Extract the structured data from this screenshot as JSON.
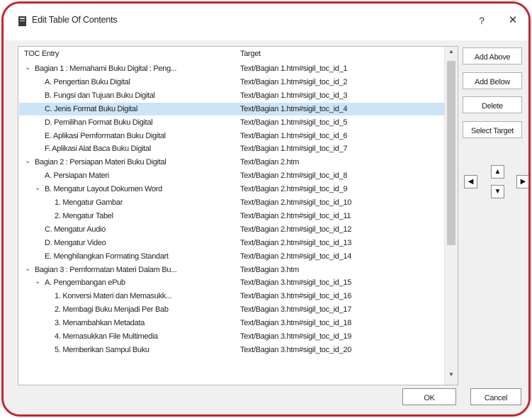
{
  "window": {
    "title": "Edit Table Of Contents",
    "help_label": "?",
    "close_label": "✕"
  },
  "columns": {
    "entry": "TOC Entry",
    "target": "Target"
  },
  "rows": [
    {
      "level": 0,
      "expand": "⌄",
      "entry": "Bagian 1 : Memahami Buku Digital : Peng...",
      "target": "Text/Bagian 1.htm#sigil_toc_id_1"
    },
    {
      "level": 1,
      "expand": "",
      "entry": "A. Pengertian Buku Digital",
      "target": "Text/Bagian 1.htm#sigil_toc_id_2"
    },
    {
      "level": 1,
      "expand": "",
      "entry": "B. Fungsi dan Tujuan Buku Digital",
      "target": "Text/Bagian 1.htm#sigil_toc_id_3"
    },
    {
      "level": 1,
      "expand": "",
      "entry": "C. Jenis Format Buku Digital",
      "target": "Text/Bagian 1.htm#sigil_toc_id_4",
      "selected": true
    },
    {
      "level": 1,
      "expand": "",
      "entry": "D. Pemilihan Format Buku Digital",
      "target": "Text/Bagian 1.htm#sigil_toc_id_5"
    },
    {
      "level": 1,
      "expand": "",
      "entry": "E. Aplikasi Pemformatan Buku Digital",
      "target": "Text/Bagian 1.htm#sigil_toc_id_6"
    },
    {
      "level": 1,
      "expand": "",
      "entry": "F. Aplikasi Alat Baca Buku Digital",
      "target": "Text/Bagian 1.htm#sigil_toc_id_7"
    },
    {
      "level": 0,
      "expand": "⌄",
      "entry": "Bagian 2 : Persiapan Materi Buku Digital",
      "target": "Text/Bagian 2.htm"
    },
    {
      "level": 1,
      "expand": "",
      "entry": "A. Persiapan Materi",
      "target": "Text/Bagian 2.htm#sigil_toc_id_8"
    },
    {
      "level": 1,
      "expand": "⌄",
      "entry": "B. Mengatur Layout Dokumen Word",
      "target": "Text/Bagian 2.htm#sigil_toc_id_9"
    },
    {
      "level": 2,
      "expand": "",
      "entry": "1. Mengatur Gambar",
      "target": "Text/Bagian 2.htm#sigil_toc_id_10"
    },
    {
      "level": 2,
      "expand": "",
      "entry": "2. Mengatur Tabel",
      "target": "Text/Bagian 2.htm#sigil_toc_id_11"
    },
    {
      "level": 1,
      "expand": "",
      "entry": "C. Mengatur Audio",
      "target": "Text/Bagian 2.htm#sigil_toc_id_12"
    },
    {
      "level": 1,
      "expand": "",
      "entry": "D. Mengatur Video",
      "target": "Text/Bagian 2.htm#sigil_toc_id_13"
    },
    {
      "level": 1,
      "expand": "",
      "entry": "E. Menghilangkan Formating Standart",
      "target": "Text/Bagian 2.htm#sigil_toc_id_14"
    },
    {
      "level": 0,
      "expand": "⌄",
      "entry": "Bagian 3 : Pemformatan Materi Dalam Bu...",
      "target": "Text/Bagian 3.htm"
    },
    {
      "level": 1,
      "expand": "⌄",
      "entry": "A. Pengembangan ePub",
      "target": "Text/Bagian 3.htm#sigil_toc_id_15"
    },
    {
      "level": 2,
      "expand": "",
      "entry": "1. Konversi Materi dan Memasukk...",
      "target": "Text/Bagian 3.htm#sigil_toc_id_16"
    },
    {
      "level": 2,
      "expand": "",
      "entry": "2. Membagi Buku Menjadi Per Bab",
      "target": "Text/Bagian 3.htm#sigil_toc_id_17"
    },
    {
      "level": 2,
      "expand": "",
      "entry": "3. Menambahkan Metadata",
      "target": "Text/Bagian 3.htm#sigil_toc_id_18"
    },
    {
      "level": 2,
      "expand": "",
      "entry": "4. Memasukkan File Multimedia",
      "target": "Text/Bagian 3.htm#sigil_toc_id_19"
    },
    {
      "level": 2,
      "expand": "",
      "entry": "5. Memberikan Sampul Buku",
      "target": "Text/Bagian 3.htm#sigil_toc_id_20"
    }
  ],
  "buttons": {
    "add_above": "Add Above",
    "add_below": "Add Below",
    "delete": "Delete",
    "select_target": "Select Target",
    "ok": "OK",
    "cancel": "Cancel"
  },
  "arrows": {
    "left": "◀",
    "up": "▲",
    "down": "▼",
    "right": "▶"
  },
  "colors": {
    "frame": "#c4262e",
    "selection": "#cce4f7"
  },
  "icons": {
    "app": "book-icon",
    "help": "help-icon",
    "close": "close-icon",
    "expand": "chevron-down-icon"
  }
}
